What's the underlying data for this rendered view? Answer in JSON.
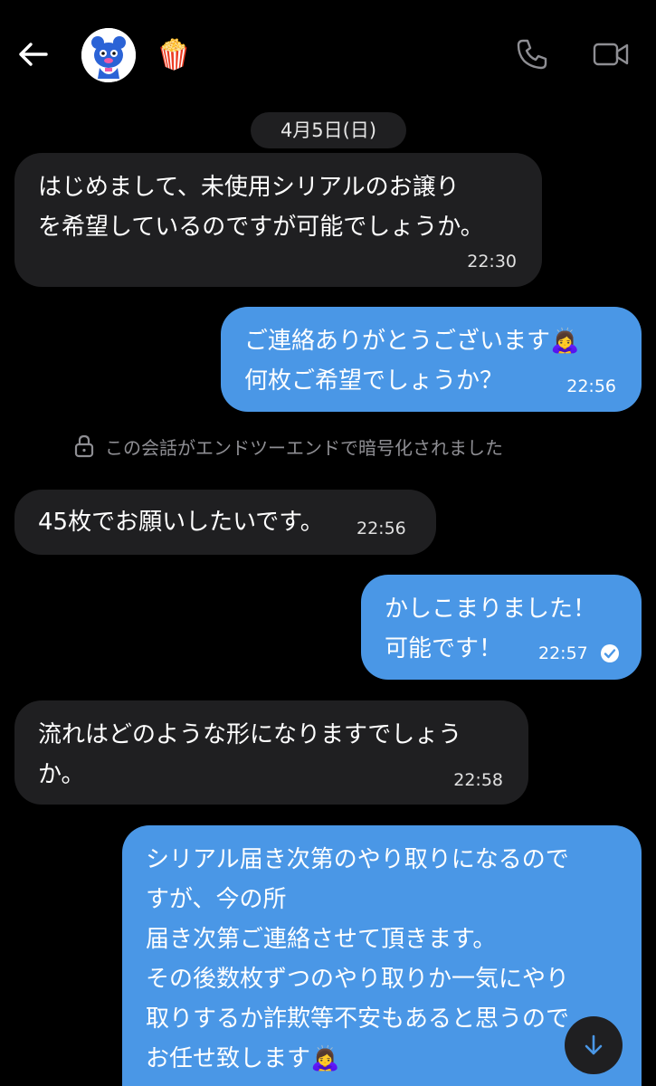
{
  "header": {
    "contact_name": "🍿",
    "back_icon": "arrow-left-icon",
    "call_icon": "phone-icon",
    "video_icon": "video-camera-icon"
  },
  "date_divider": "4月5日(日)",
  "encryption_notice": "この会話がエンドツーエンドで暗号化されました",
  "messages": [
    {
      "direction": "in",
      "text": "はじめまして、未使用シリアルのお譲り\nを希望しているのですが可能でしょうか。",
      "time": "22:30"
    },
    {
      "direction": "out",
      "text": "ご連絡ありがとうございます🙇‍♀️\n何枚ご希望でしょうか？",
      "time": "22:56"
    },
    {
      "direction": "in",
      "text": "45枚でお願いしたいです。",
      "time": "22:56"
    },
    {
      "direction": "out",
      "text": "かしこまりました！\n可能です！",
      "time": "22:57",
      "status": "read-check-icon"
    },
    {
      "direction": "in",
      "text": "流れはどのような形になりますでしょう\nか。",
      "time": "22:58"
    },
    {
      "direction": "out",
      "text": "シリアル届き次第のやり取りになるので\nすが、今の所\n届き次第ご連絡させて頂きます。\nその後数枚ずつのやり取りか一気にやり\n取りするか詐欺等不安もあると思うので\nお任せ致します🙇‍♀️"
    }
  ],
  "scroll_icon": "arrow-down-icon",
  "colors": {
    "background": "#000000",
    "incoming": "#1f1f21",
    "outgoing": "#4a97e6"
  }
}
